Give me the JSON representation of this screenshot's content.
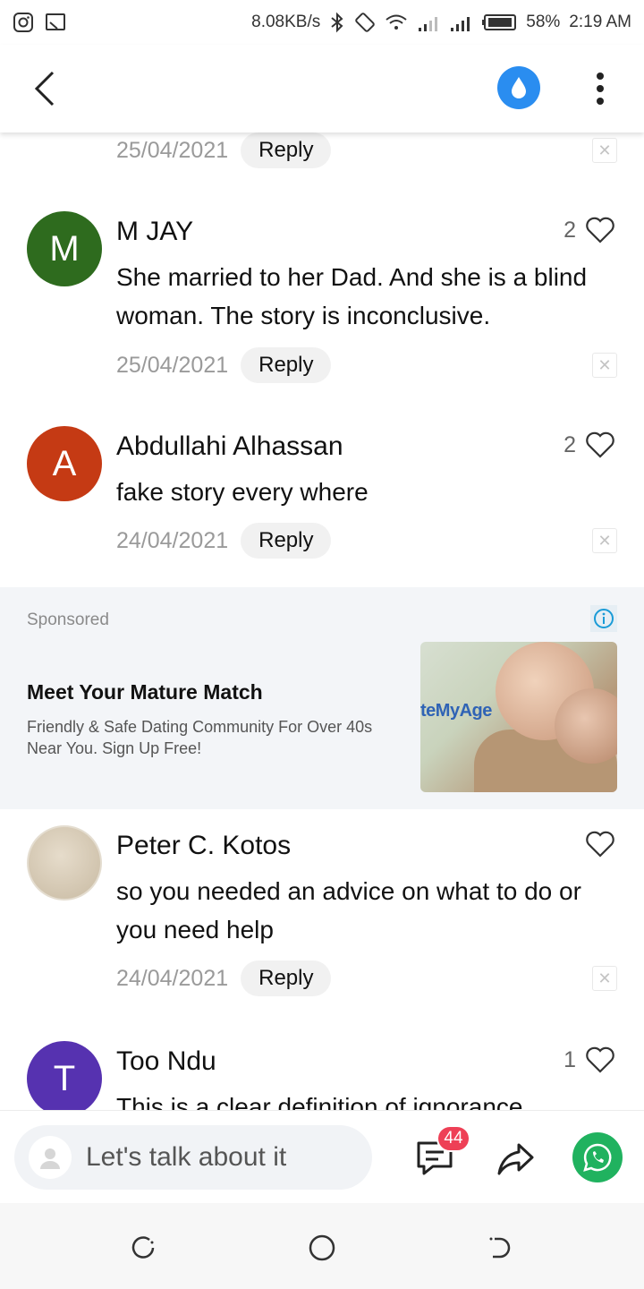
{
  "status_bar": {
    "speed": "8.08KB/s",
    "battery": "58%",
    "time": "2:19 AM"
  },
  "colors": {
    "accent_blue": "#2a8df0",
    "badge_red": "#ee4056",
    "whatsapp_green": "#20b25f"
  },
  "first_partial": {
    "date": "25/04/2021",
    "reply": "Reply"
  },
  "comments": [
    {
      "initial": "M",
      "avatar_color": "#2e6b1e",
      "name": "M JAY",
      "text": "She married to her Dad.  And she is a blind woman.  The story is inconclusive.",
      "likes": "2",
      "date": "25/04/2021",
      "reply": "Reply"
    },
    {
      "initial": "A",
      "avatar_color": "#c53a14",
      "name": "Abdullahi Alhassan",
      "text": "fake story every where",
      "likes": "2",
      "date": "24/04/2021",
      "reply": "Reply"
    },
    {
      "initial": "",
      "avatar_color": "#d8cfc0",
      "name": "Peter C. Kotos",
      "text": "so you needed an advice on what to do or you need help",
      "likes": "",
      "date": "24/04/2021",
      "reply": "Reply"
    },
    {
      "initial": "T",
      "avatar_color": "#5632b0",
      "name": "Too Ndu",
      "text": "This is a clear definition of ignorance",
      "likes": "1"
    }
  ],
  "ad": {
    "sponsored": "Sponsored",
    "title": "Meet Your Mature Match",
    "description": "Friendly & Safe Dating Community For Over 40s Near You. Sign Up Free!",
    "image_brand_text": "teMyAge"
  },
  "bottom": {
    "input_placeholder": "Let's talk about it",
    "comment_count": "44"
  }
}
